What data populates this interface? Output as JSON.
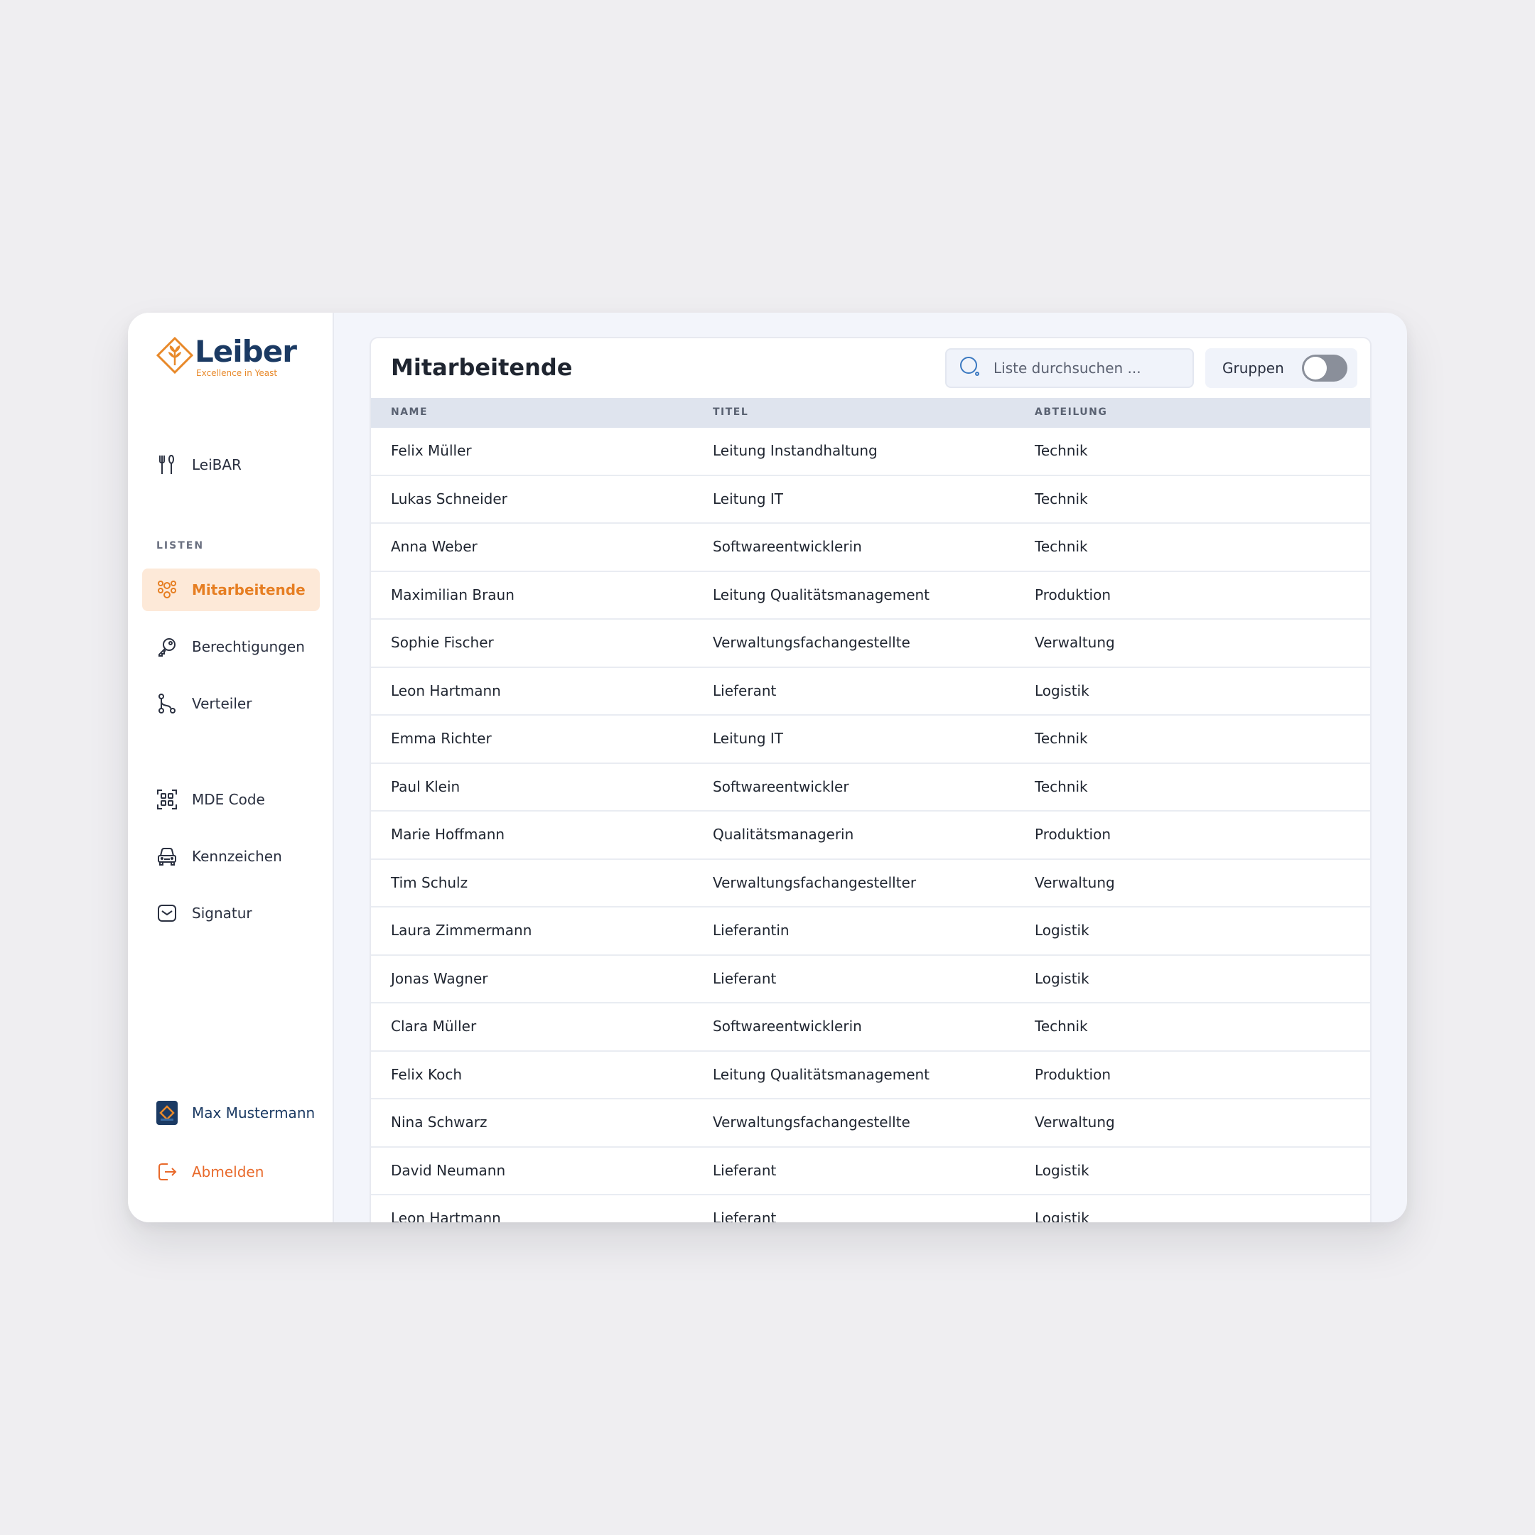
{
  "brand": {
    "name": "Leiber",
    "tagline": "Excellence in Yeast",
    "accent": "#e67e22",
    "primary": "#1b3a63"
  },
  "sidebar": {
    "top_item": {
      "label": "LeiBAR",
      "icon": "fork-knife-icon"
    },
    "section_label": "LISTEN",
    "list_items": [
      {
        "label": "Mitarbeitende",
        "icon": "people-icon",
        "active": true
      },
      {
        "label": "Berechtigungen",
        "icon": "key-icon"
      },
      {
        "label": "Verteiler",
        "icon": "branch-icon"
      }
    ],
    "tool_items": [
      {
        "label": "MDE Code",
        "icon": "qr-code-icon"
      },
      {
        "label": "Kennzeichen",
        "icon": "car-icon"
      },
      {
        "label": "Signatur",
        "icon": "mail-icon"
      }
    ],
    "user": {
      "name": "Max Mustermann"
    },
    "logout": {
      "label": "Abmelden",
      "icon": "logout-icon"
    }
  },
  "main": {
    "title": "Mitarbeitende",
    "search": {
      "placeholder": "Liste durchsuchen ...",
      "value": ""
    },
    "groups_toggle": {
      "label": "Gruppen",
      "on": false
    },
    "table": {
      "columns": [
        "NAME",
        "TITEL",
        "ABTEILUNG"
      ],
      "rows": [
        [
          "Felix Müller",
          "Leitung Instandhaltung",
          "Technik"
        ],
        [
          "Lukas Schneider",
          "Leitung IT",
          "Technik"
        ],
        [
          "Anna Weber",
          "Softwareentwicklerin",
          "Technik"
        ],
        [
          "Maximilian Braun",
          "Leitung Qualitätsmanagement",
          "Produktion"
        ],
        [
          "Sophie Fischer",
          "Verwaltungsfachangestellte",
          "Verwaltung"
        ],
        [
          "Leon Hartmann",
          "Lieferant",
          "Logistik"
        ],
        [
          "Emma Richter",
          "Leitung IT",
          "Technik"
        ],
        [
          "Paul Klein",
          "Softwareentwickler",
          "Technik"
        ],
        [
          "Marie Hoffmann",
          "Qualitätsmanagerin",
          "Produktion"
        ],
        [
          "Tim Schulz",
          "Verwaltungsfachangestellter",
          "Verwaltung"
        ],
        [
          "Laura Zimmermann",
          "Lieferantin",
          "Logistik"
        ],
        [
          "Jonas Wagner",
          "Lieferant",
          "Logistik"
        ],
        [
          "Clara Müller",
          "Softwareentwicklerin",
          "Technik"
        ],
        [
          "Felix Koch",
          "Leitung Qualitätsmanagement",
          "Produktion"
        ],
        [
          "Nina Schwarz",
          "Verwaltungsfachangestellte",
          "Verwaltung"
        ],
        [
          "David Neumann",
          "Lieferant",
          "Logistik"
        ],
        [
          "Leon Hartmann",
          "Lieferant",
          "Logistik"
        ]
      ]
    }
  }
}
